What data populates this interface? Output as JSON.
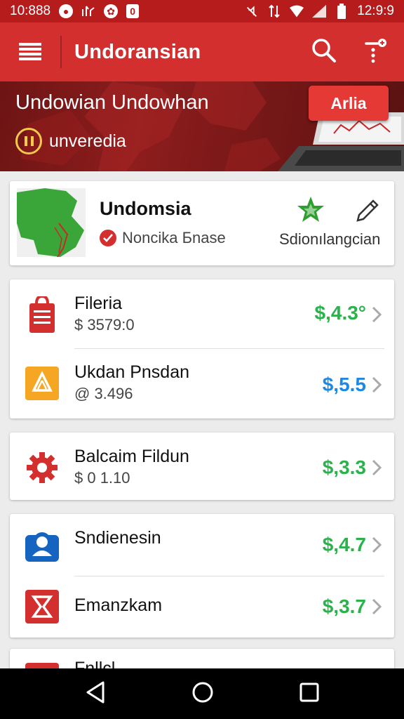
{
  "status_bar": {
    "time_left": "10:888",
    "time_right": "12:9:9",
    "badge": "0"
  },
  "app_bar": {
    "title": "Undoransian"
  },
  "banner": {
    "title": "Undowian Undowhan",
    "subtitle": "unveredia",
    "button": "Arlia"
  },
  "profile": {
    "name": "Undomsia",
    "status": "Noncika Бnase",
    "link": "Sdionılangcian"
  },
  "accounts": [
    {
      "title": "Fileria",
      "sub": "$ 3579:0",
      "value": "$,4.3°",
      "value_color": "#2bb24c",
      "icon": "bag-icon"
    },
    {
      "title": "Ukdan Pnsdan",
      "sub": "@ 3.496",
      "value": "$,5.5",
      "value_color": "#1e88e5",
      "icon": "up-arrow-icon"
    },
    {
      "title": "Balcaim Fildun",
      "sub": "$ 0 1.10",
      "value": "$,3.3",
      "value_color": "#2bb24c",
      "icon": "gear-icon"
    },
    {
      "title": "Sndienesin",
      "sub": "",
      "value": "$,4.7",
      "value_color": "#2bb24c",
      "icon": "user-icon"
    },
    {
      "title": "Emanzkam",
      "sub": "",
      "value": "$,3.7",
      "value_color": "#2bb24c",
      "icon": "hourglass-icon"
    }
  ],
  "peek": {
    "title": "Fnllcl..."
  },
  "colors": {
    "primary": "#d32f2f",
    "status": "#b71c1c",
    "green": "#2bb24c",
    "blue": "#1e88e5"
  }
}
